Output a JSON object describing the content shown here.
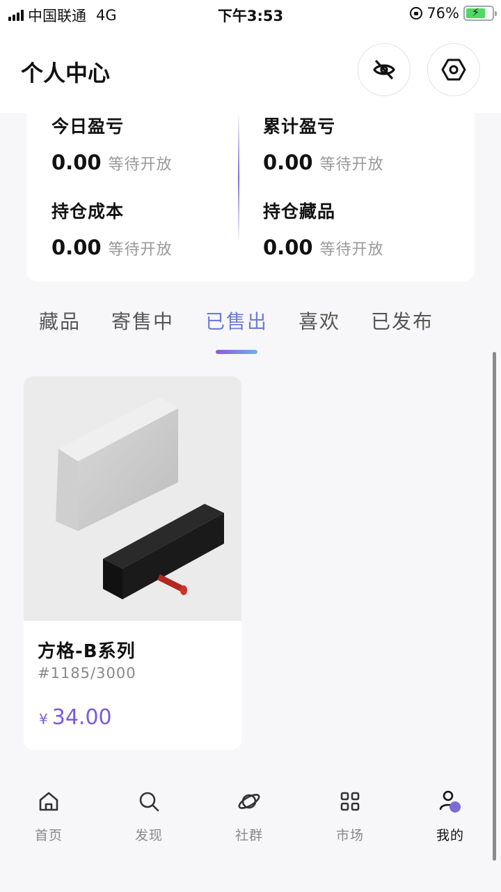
{
  "status_bar": {
    "carrier": "中国联通",
    "network": "4G",
    "time": "下午3:53",
    "battery_percent": "76%"
  },
  "header": {
    "title": "个人中心",
    "hide_icon": "eye-off-icon",
    "settings_icon": "hexagon-settings-icon"
  },
  "stats": {
    "today_pl": {
      "label": "今日盈亏",
      "value": "0.00",
      "note": "等待开放"
    },
    "total_pl": {
      "label": "累计盈亏",
      "value": "0.00",
      "note": "等待开放"
    },
    "holding_cost": {
      "label": "持仓成本",
      "value": "0.00",
      "note": "等待开放"
    },
    "holding_items": {
      "label": "持仓藏品",
      "value": "0.00",
      "note": "等待开放"
    }
  },
  "tabs": [
    {
      "label": "藏品",
      "active": false
    },
    {
      "label": "寄售中",
      "active": false
    },
    {
      "label": "已售出",
      "active": true
    },
    {
      "label": "喜欢",
      "active": false
    },
    {
      "label": "已发布",
      "active": false
    }
  ],
  "items": [
    {
      "title": "方格-B系列",
      "serial": "#1185/3000",
      "currency": "¥",
      "price": "34.00"
    }
  ],
  "bottom_nav": [
    {
      "label": "首页",
      "icon": "home-icon",
      "active": false
    },
    {
      "label": "发现",
      "icon": "search-icon",
      "active": false
    },
    {
      "label": "社群",
      "icon": "planet-icon",
      "active": false
    },
    {
      "label": "市场",
      "icon": "grid-icon",
      "active": false
    },
    {
      "label": "我的",
      "icon": "user-icon",
      "active": true
    }
  ],
  "colors": {
    "accent": "#7a5be0",
    "tab_active": "#6e7bd9",
    "background": "#f7f7f9"
  }
}
